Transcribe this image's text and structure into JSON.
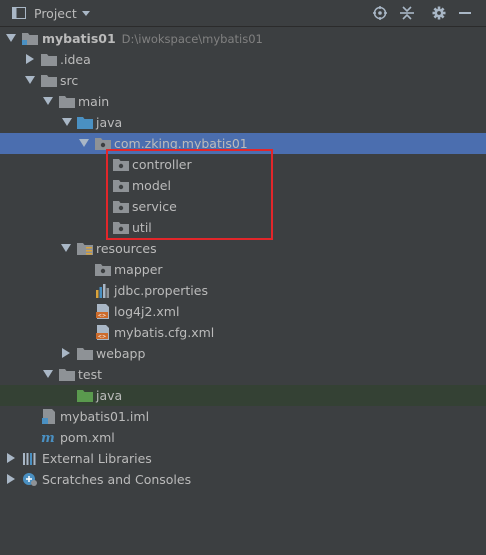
{
  "header": {
    "title": "Project",
    "icons": [
      "project-view-icon",
      "dropdown-icon",
      "locate-icon",
      "collapse-all-icon",
      "settings-icon",
      "hide-icon"
    ]
  },
  "tree": {
    "root_name": "mybatis01",
    "root_path": "D:\\iwokspace\\mybatis01",
    "idea": ".idea",
    "src": "src",
    "main": "main",
    "java": "java",
    "package": "com.zking.mybatis01",
    "controller": "controller",
    "model": "model",
    "service": "service",
    "util": "util",
    "resources": "resources",
    "mapper": "mapper",
    "jdbc": "jdbc.properties",
    "log4j2": "log4j2.xml",
    "mybatis_cfg": "mybatis.cfg.xml",
    "webapp": "webapp",
    "test": "test",
    "test_java": "java",
    "iml": "mybatis01.iml",
    "pom": "pom.xml",
    "ext_libs": "External Libraries",
    "scratches": "Scratches and Consoles"
  },
  "colors": {
    "background": "#3c3f41",
    "selection": "#4b6eaf",
    "folder": "#8e9296",
    "source_folder": "#4a90c2",
    "test_folder": "#5a9a4e",
    "highlight": "#e2262a"
  }
}
